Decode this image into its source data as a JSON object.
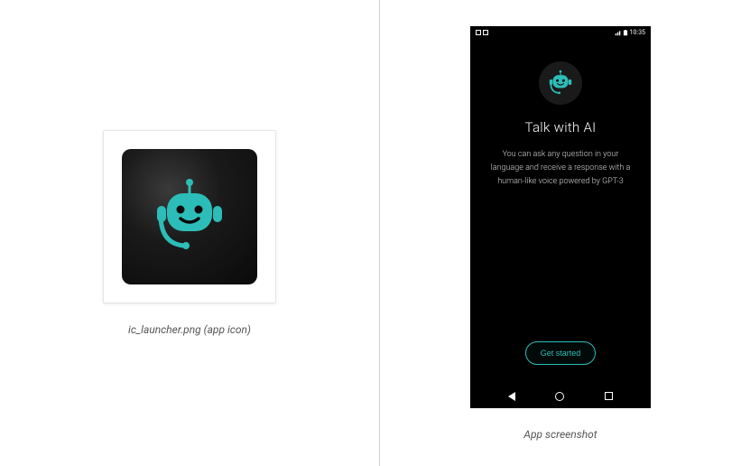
{
  "left": {
    "caption": "ic_launcher.png (app icon)"
  },
  "right": {
    "caption": "App screenshot",
    "phone": {
      "status_time": "10:35",
      "title": "Talk with AI",
      "description": "You can ask any question in your language and receive a response with a human-like voice powered by GPT-3",
      "cta": "Get started"
    }
  },
  "colors": {
    "accent": "#2dbdb8"
  }
}
